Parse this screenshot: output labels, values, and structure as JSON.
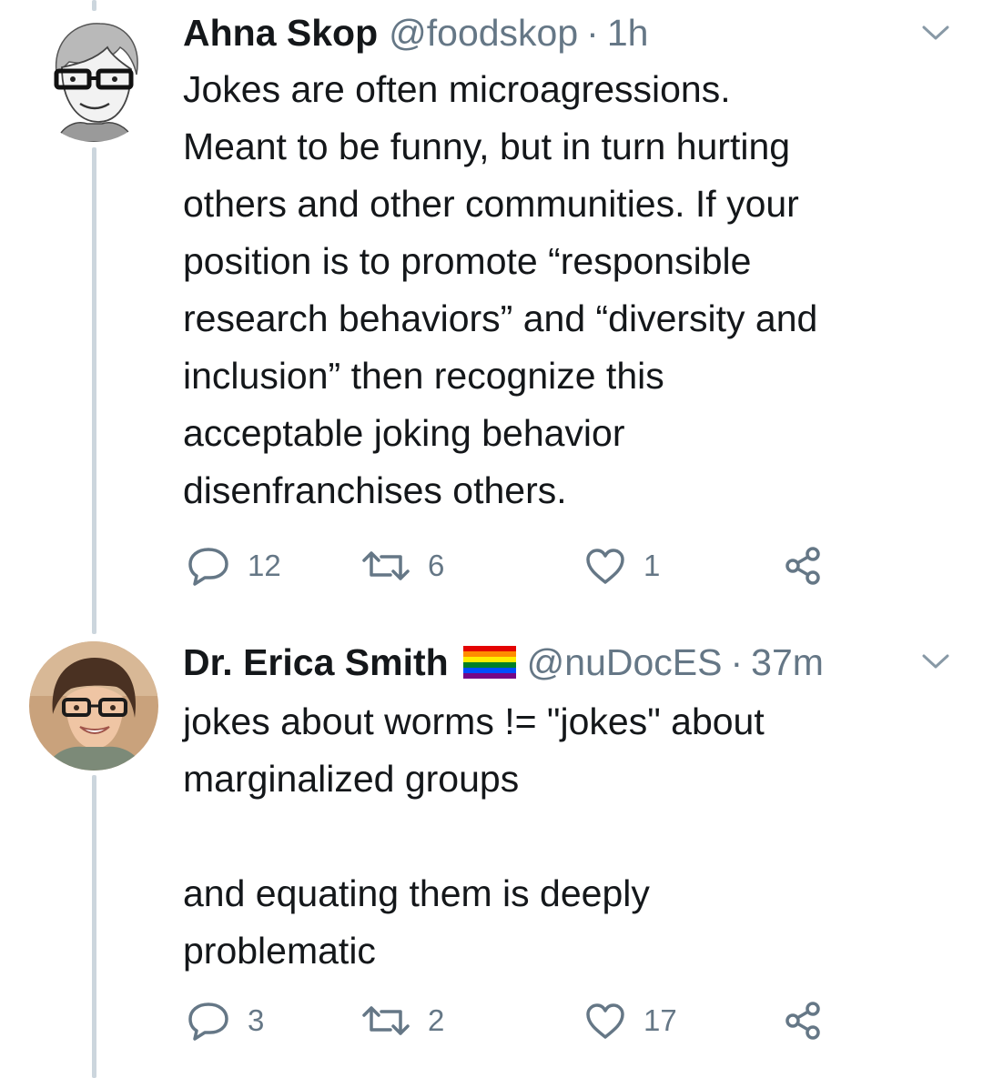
{
  "thread": [
    {
      "author": {
        "display_name": "Ahna Skop",
        "handle": "@foodskop",
        "timestamp": "1h",
        "separator": "·",
        "avatar": "avatar-sketch-woman-glasses"
      },
      "text": "Jokes are often microagressions.\nMeant to be funny, but in turn hurting\nothers and other communities. If your\nposition is to promote “responsible\nresearch behaviors” and “diversity and\ninclusion” then recognize this\nacceptable joking behavior\ndisenfranchises others.",
      "actions": {
        "reply_count": "12",
        "retweet_count": "6",
        "like_count": "1"
      }
    },
    {
      "author": {
        "display_name": "Dr. Erica Smith",
        "name_emoji": "rainbow-flag",
        "handle": "@nuDocES",
        "timestamp": "37m",
        "separator": "·",
        "avatar": "avatar-photo-woman-glasses"
      },
      "text": "jokes about worms != \"jokes\" about\nmarginalized groups\n\nand equating them is deeply\nproblematic",
      "actions": {
        "reply_count": "3",
        "retweet_count": "2",
        "like_count": "17"
      }
    }
  ],
  "icons": {
    "reply": "speech-bubble-icon",
    "retweet": "retweet-arrows-icon",
    "like": "heart-icon",
    "share": "share-nodes-icon",
    "menu": "chevron-down-icon"
  },
  "colors": {
    "text_primary": "#14171a",
    "text_secondary": "#657786",
    "thread_line": "#ccd6dd"
  }
}
